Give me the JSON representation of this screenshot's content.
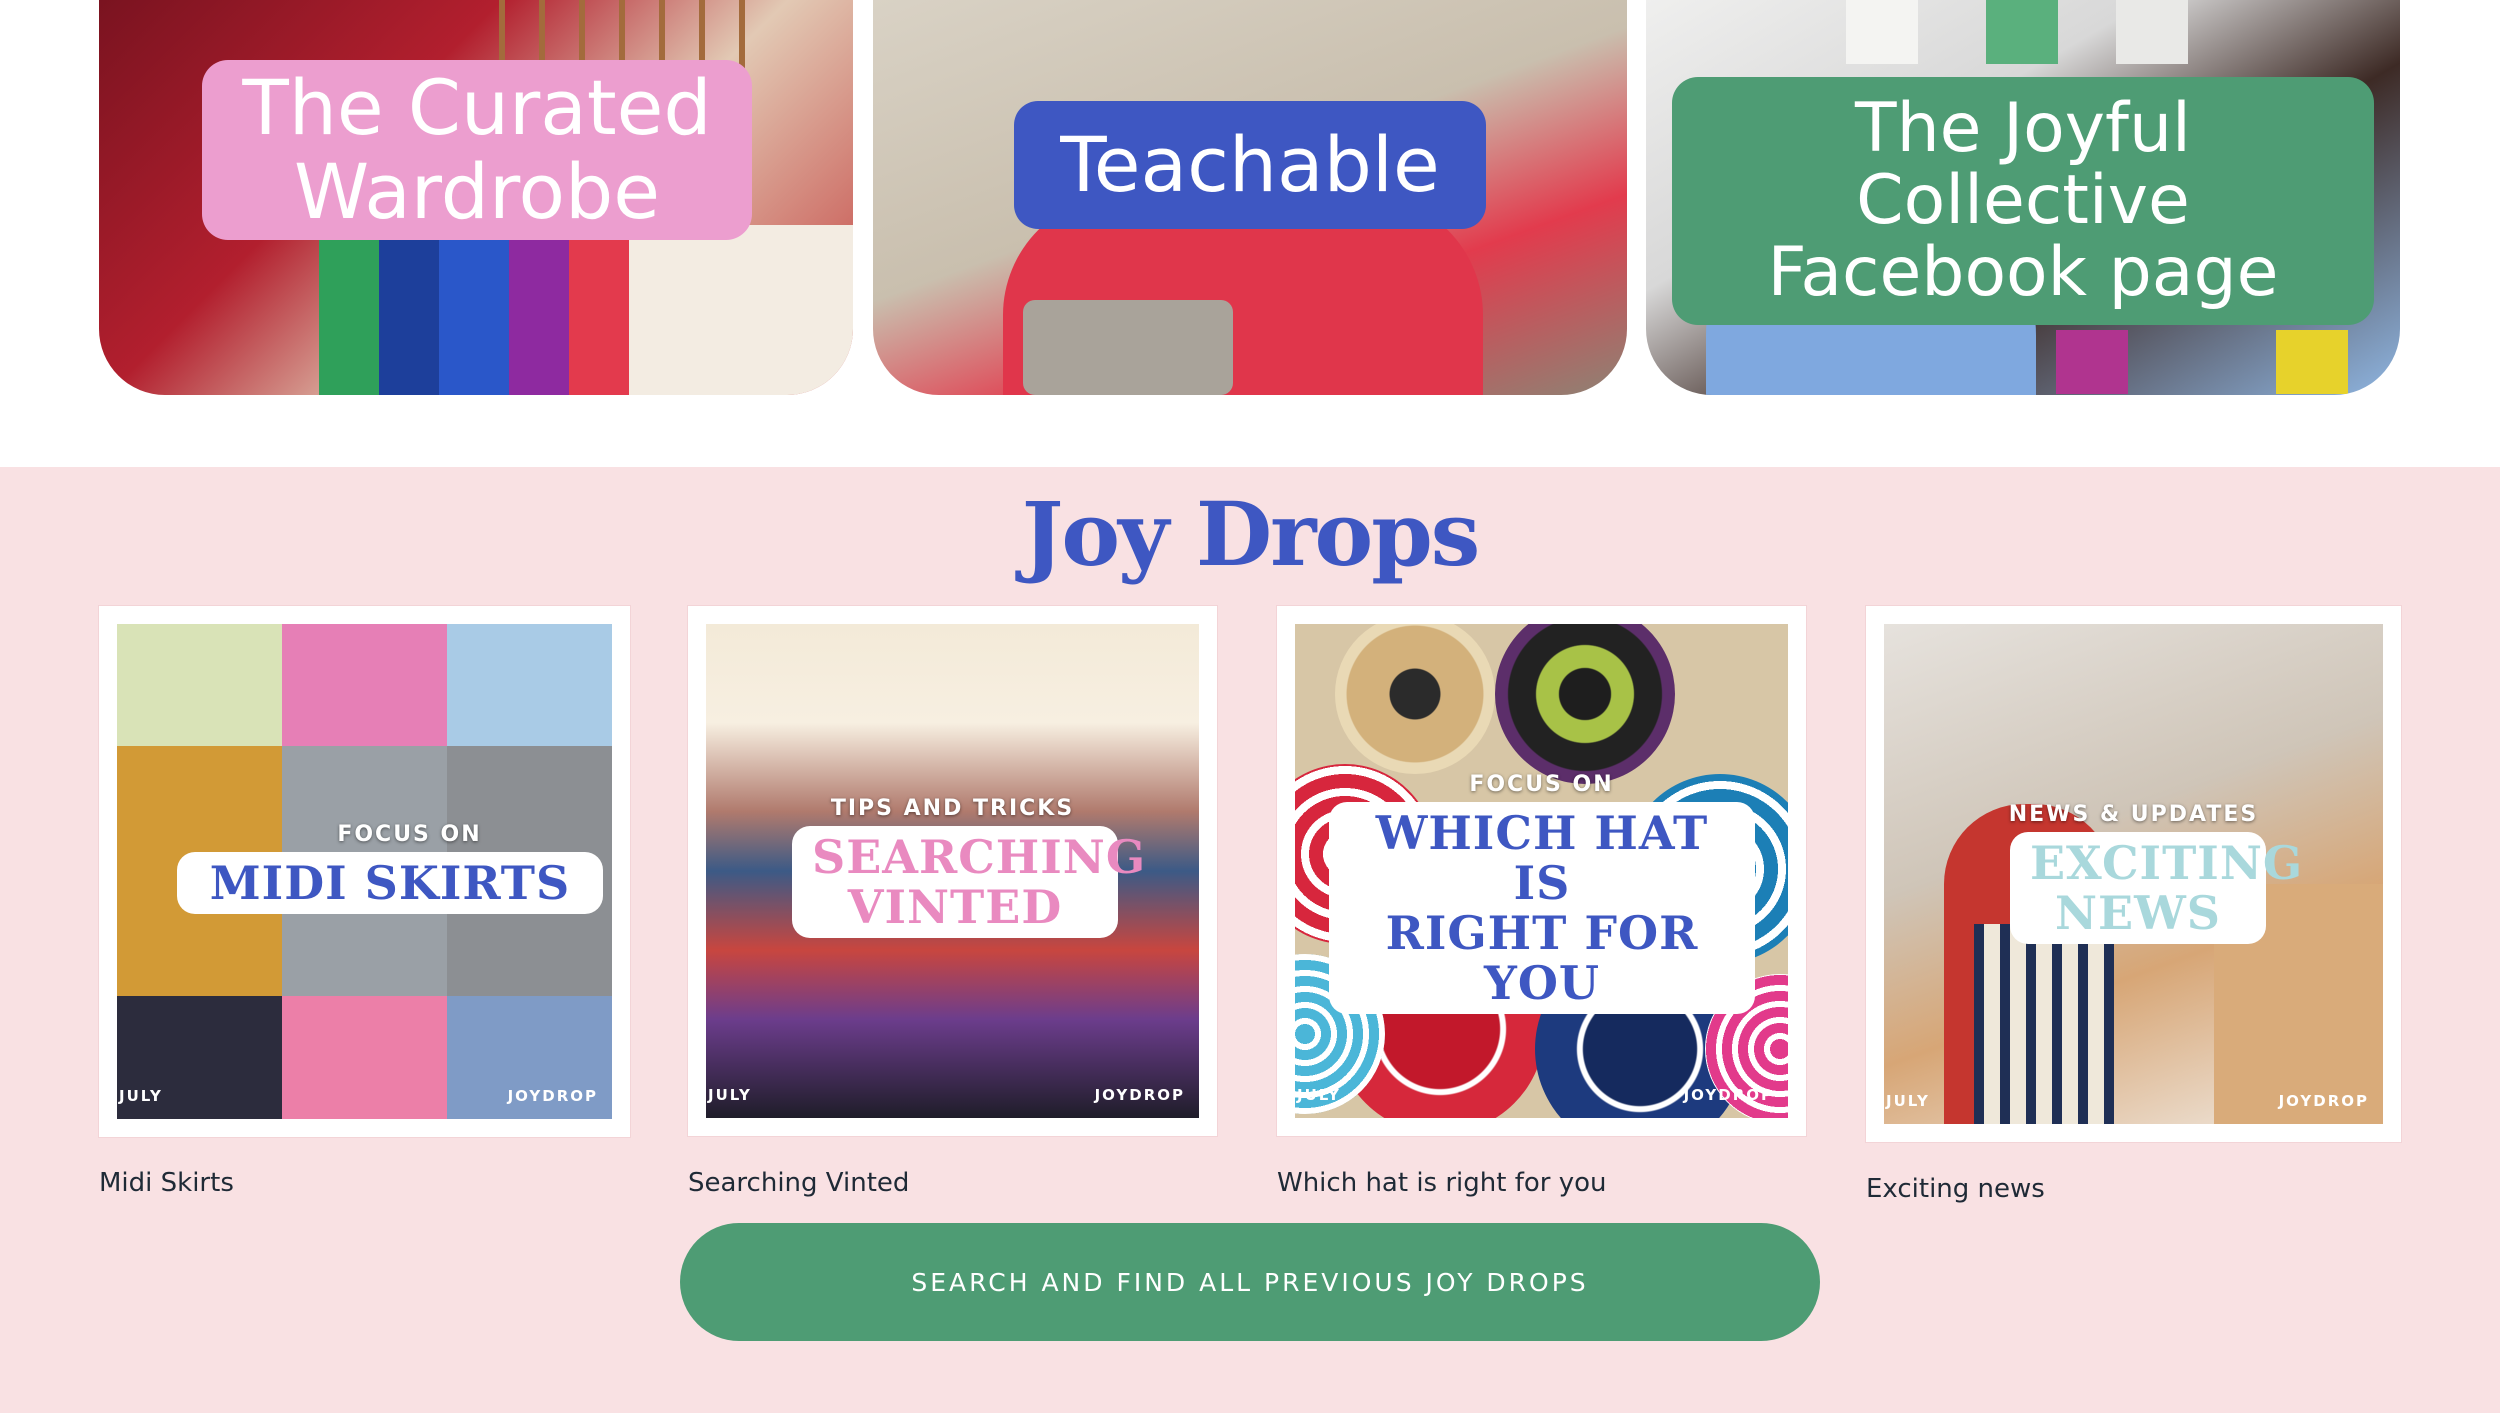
{
  "hero_cards": [
    {
      "label_line1": "The Curated",
      "label_line2": "Wardrobe",
      "color": "#ec9ecf"
    },
    {
      "label_line1": "Teachable",
      "label_line2": "",
      "color": "#3e57c2"
    },
    {
      "label_line1": "The Joyful Collective",
      "label_line2": "Facebook page",
      "color": "#4e9c74"
    }
  ],
  "joy_drops": {
    "title": "Joy Drops",
    "title_color": "#3e57c2",
    "background": "#f9e1e3",
    "items": [
      {
        "overline": "FOCUS ON",
        "headline_line1": "MIDI SKIRTS",
        "headline_line2": "",
        "headline_color": "#3e57c2",
        "corner_left": "JULY",
        "corner_right": "JOYDROP",
        "caption": "Midi Skirts"
      },
      {
        "overline": "TIPS AND TRICKS",
        "headline_line1": "SEARCHING",
        "headline_line2": "VINTED",
        "headline_color": "#e98ac0",
        "corner_left": "JULY",
        "corner_right": "JOYDROP",
        "caption": "Searching Vinted"
      },
      {
        "overline": "FOCUS ON",
        "headline_line1": "WHICH HAT IS",
        "headline_line2": "RIGHT FOR YOU",
        "headline_color": "#3e57c2",
        "corner_left": "JULY",
        "corner_right": "JOYDROP",
        "caption": "Which hat is right for you"
      },
      {
        "overline": "NEWS & UPDATES",
        "headline_line1": "EXCITING",
        "headline_line2": "NEWS",
        "headline_color": "#a9d8dc",
        "corner_left": "JULY",
        "corner_right": "JOYDROP",
        "caption": "Exciting news"
      }
    ],
    "cta_label": "SEARCH AND FIND ALL PREVIOUS JOY DROPS",
    "cta_color": "#4e9c74"
  }
}
